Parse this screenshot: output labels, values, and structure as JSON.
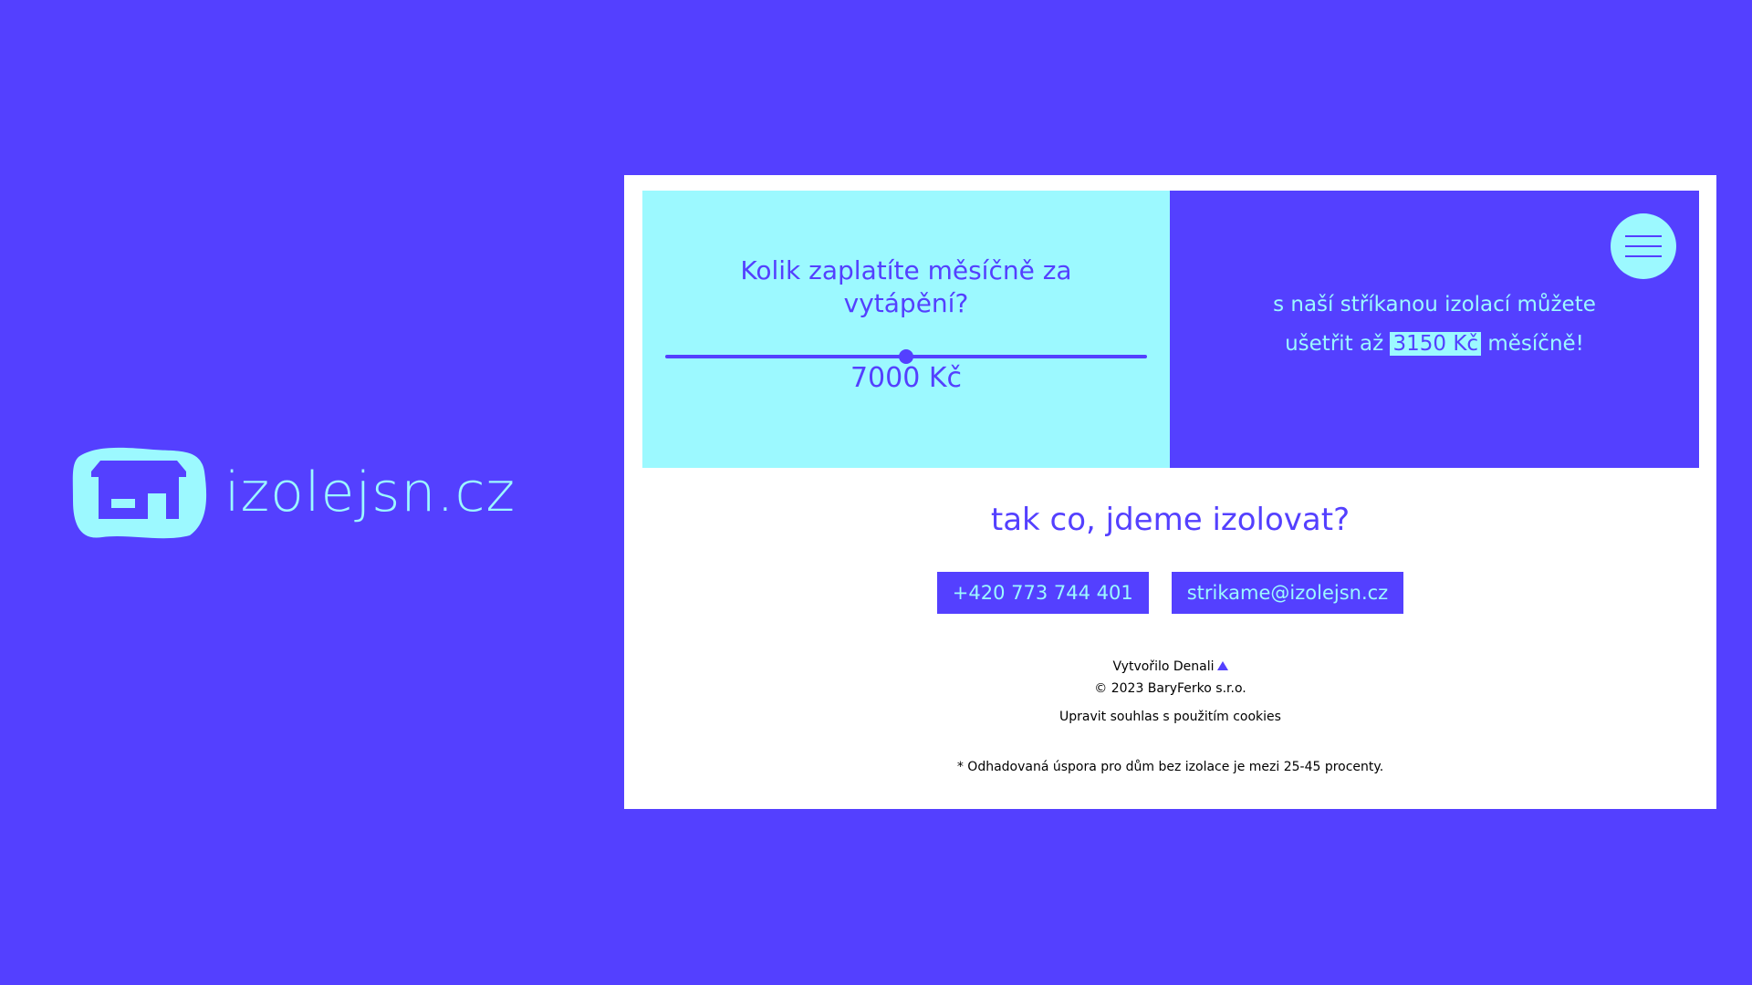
{
  "brand": {
    "name": "izolejsn.cz"
  },
  "calculator": {
    "question": "Kolik zaplatíte měsíčně za vytápění?",
    "slider_fraction": 0.5,
    "slider_value": "7000 Kč"
  },
  "savings": {
    "line1": "s naší stříkanou izolací můžete",
    "line2_prefix": "ušetřit až",
    "amount": "3150 Kč",
    "line2_suffix": "měsíčně!"
  },
  "cta": {
    "title": "tak co, jdeme izolovat?",
    "phone": "+420 773 744 401",
    "email": "strikame@izolejsn.cz"
  },
  "footer": {
    "created_by": "Vytvořilo Denali",
    "copyright": "© 2023 BaryFerko s.r.o.",
    "cookies": "Upravit souhlas s použitím cookies",
    "note": "* Odhadovaná úspora pro dům bez izolace je mezi 25-45 procenty."
  },
  "icons": {
    "logo": "house-logo-icon",
    "menu": "hamburger-menu-icon",
    "denali": "triangle-icon"
  },
  "colors": {
    "primary": "#5440FF",
    "accent": "#9CF9FF",
    "card": "#FFFFFF",
    "text": "#000000"
  }
}
